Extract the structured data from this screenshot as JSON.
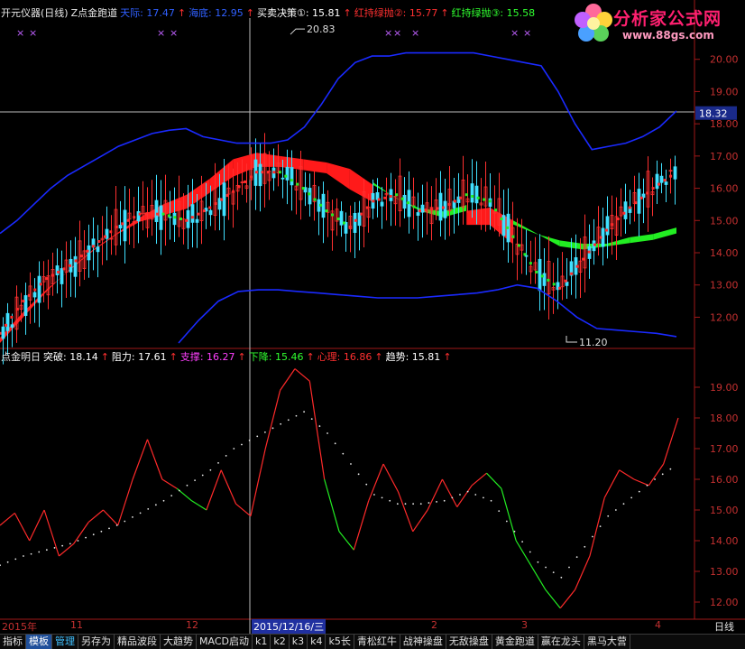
{
  "top_legend": [
    {
      "text": "开元仪器(日线)",
      "color": "#e8e8e8"
    },
    {
      "text": "Z点金跑道",
      "color": "#e8e8e8"
    },
    {
      "text": "天际: 17.47",
      "color": "#3060ff"
    },
    {
      "text": "↑",
      "color": "#ff3030"
    },
    {
      "text": "海底: 12.95",
      "color": "#3060ff"
    },
    {
      "text": "↑",
      "color": "#ff3030"
    },
    {
      "text": "买卖决策①: 15.81",
      "color": "#ffffff"
    },
    {
      "text": "↑",
      "color": "#ff3030"
    },
    {
      "text": "红持绿抛②: 15.77",
      "color": "#ff3030"
    },
    {
      "text": "↑",
      "color": "#ff3030"
    },
    {
      "text": "红持绿抛③: 15.58",
      "color": "#30ff30"
    }
  ],
  "sub_legend": [
    {
      "text": "点金明日",
      "color": "#e8e8e8"
    },
    {
      "text": "突破: 18.14",
      "color": "#ffffff"
    },
    {
      "text": "↑",
      "color": "#ff3030"
    },
    {
      "text": "阻力: 17.61",
      "color": "#ffffff"
    },
    {
      "text": "↑",
      "color": "#ff3030"
    },
    {
      "text": "支撑: 16.27",
      "color": "#ff40ff"
    },
    {
      "text": "↑",
      "color": "#ff3030"
    },
    {
      "text": "下降: 15.46",
      "color": "#30ff30"
    },
    {
      "text": "↑",
      "color": "#ff3030"
    },
    {
      "text": "心理: 16.86",
      "color": "#ff3030"
    },
    {
      "text": "↑",
      "color": "#ff3030"
    },
    {
      "text": "趋势: 15.81",
      "color": "#ffffff"
    },
    {
      "text": "↑",
      "color": "#ff3030"
    }
  ],
  "logo": {
    "name": "分析家公式网",
    "url": "www.88gs.com"
  },
  "time_axis": {
    "labels": [
      "2015年",
      "11",
      "12",
      "2015/12/16/三",
      "2",
      "3",
      "4"
    ],
    "period": "日线"
  },
  "toolbar": [
    "指标",
    "模板",
    "管理",
    "另存为",
    "精品波段",
    "大趋势",
    "MACD启动",
    "k1",
    "k2",
    "k3",
    "k4",
    "k5长",
    "青松红牛",
    "战神操盘",
    "无敌操盘",
    "黄金跑道",
    "赢在龙头",
    "黑马大营"
  ],
  "price_marks": {
    "high": "20.83",
    "low": "11.20",
    "current": "18.32"
  },
  "chart_data": [
    {
      "type": "line",
      "title": "Z点金跑道",
      "y_ticks": [
        12.0,
        13.0,
        14.0,
        15.0,
        16.0,
        17.0,
        18.0,
        19.0,
        20.0
      ],
      "ylim": [
        11.2,
        21.0
      ],
      "current_price": 18.32,
      "high_mark": 20.83,
      "low_mark": 11.2,
      "series": [
        {
          "name": "天际",
          "values": [
            14.6,
            15.0,
            15.5,
            16.0,
            16.4,
            16.7,
            17.0,
            17.3,
            17.5,
            17.7,
            17.8,
            17.85,
            17.6,
            17.5,
            17.4,
            17.4,
            17.4,
            17.5,
            17.9,
            18.6,
            19.4,
            19.9,
            20.1,
            20.1,
            20.2,
            20.2,
            20.2,
            20.2,
            20.2,
            20.1,
            20.0,
            19.9,
            19.8,
            19.0,
            18.0,
            17.2,
            17.3,
            17.4,
            17.6,
            17.9,
            18.4
          ]
        },
        {
          "name": "海底",
          "values": [
            11.2,
            11.9,
            12.5,
            12.8,
            12.85,
            12.85,
            12.8,
            12.75,
            12.7,
            12.65,
            12.6,
            12.6,
            12.6,
            12.65,
            12.7,
            12.75,
            12.85,
            13.0,
            12.9,
            12.5,
            12.0,
            11.65,
            11.6,
            11.55,
            11.5,
            11.4
          ]
        },
        {
          "name": "买卖决策①",
          "values": [
            11.5,
            12.5,
            13.2,
            13.6,
            14.2,
            14.8,
            15.2,
            15.2,
            15.0,
            15.4,
            15.9,
            16.5,
            16.5,
            16.0,
            15.3,
            14.8,
            15.6,
            15.8,
            15.3,
            15.4,
            15.8,
            15.6,
            14.5,
            13.4,
            12.9,
            13.8,
            14.7,
            15.4,
            16.0,
            16.5
          ]
        },
        {
          "name": "红持绿抛②",
          "values": [
            11.2,
            12.0,
            12.8,
            13.5,
            14.1,
            14.6,
            15.1,
            15.5,
            15.8,
            16.3,
            16.9,
            17.1,
            17.0,
            16.9,
            16.8,
            16.6,
            16.1,
            15.7,
            15.3,
            15.1,
            15.3,
            15.4,
            15.0,
            14.6,
            14.2,
            14.1,
            14.2,
            14.3,
            14.4,
            14.6
          ]
        },
        {
          "name": "红持绿抛③",
          "values": [
            11.7,
            12.5,
            13.2,
            13.8,
            14.4,
            14.9,
            15.3,
            15.5,
            15.7,
            16.2,
            16.7,
            17.0,
            17.0,
            16.9,
            16.8,
            16.3,
            15.9,
            15.4,
            15.1,
            15.0,
            15.2,
            15.2,
            14.6,
            14.3,
            14.1,
            14.0,
            14.0,
            14.2,
            14.3,
            14.5
          ]
        }
      ]
    },
    {
      "type": "line",
      "title": "点金明日",
      "y_ticks": [
        12.0,
        13.0,
        14.0,
        15.0,
        16.0,
        17.0,
        18.0,
        19.0
      ],
      "ylim": [
        11.5,
        20.0
      ],
      "series": [
        {
          "name": "突破",
          "values": [
            14.5,
            14.9,
            14.0,
            15.0,
            13.5,
            13.9,
            14.6,
            15.0,
            14.5,
            16.0,
            17.3,
            16.0,
            15.7,
            15.3,
            15.0,
            16.3,
            15.2,
            14.8,
            17.0,
            18.9,
            19.6,
            19.2,
            16.0,
            14.3,
            13.7,
            15.3,
            16.5,
            15.6,
            14.3,
            15.0,
            16.0,
            15.1,
            15.8,
            16.2,
            15.7,
            14.0,
            13.2,
            12.4,
            11.8,
            12.4,
            13.5,
            15.4,
            16.3,
            16.0,
            15.8,
            16.5,
            18.0
          ]
        },
        {
          "name": "趋势",
          "values": [
            13.2,
            13.5,
            13.7,
            13.9,
            14.2,
            14.5,
            14.9,
            15.3,
            15.8,
            16.3,
            17.0,
            17.4,
            17.8,
            18.2,
            17.5,
            16.5,
            15.5,
            15.2,
            15.2,
            15.3,
            15.6,
            15.3,
            14.3,
            13.3,
            12.8,
            13.8,
            14.8,
            15.4,
            16.0,
            16.5
          ]
        }
      ]
    }
  ]
}
